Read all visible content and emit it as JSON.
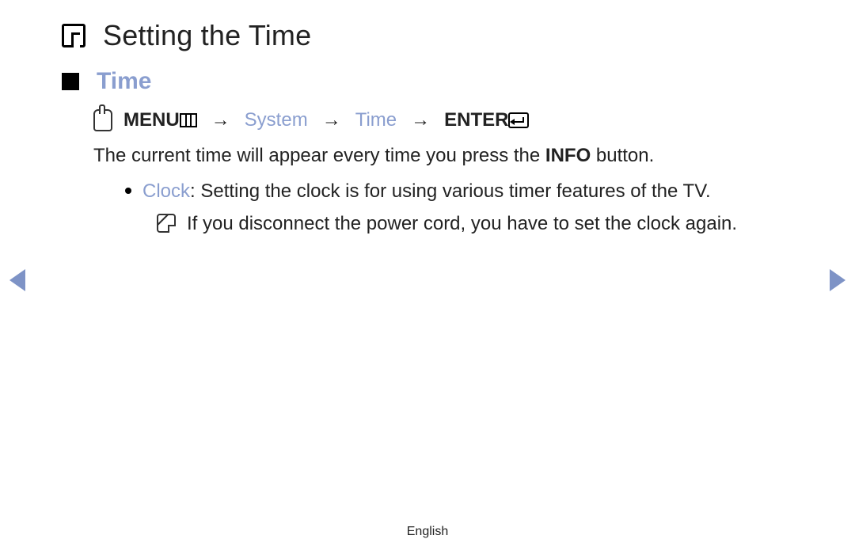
{
  "title": "Setting the Time",
  "section_heading": "Time",
  "breadcrumb": {
    "menu_label": "MENU",
    "arrow": "→",
    "system": "System",
    "time": "Time",
    "enter_label": "ENTER"
  },
  "body": {
    "line1_pre": "The current time will appear every time you press the ",
    "line1_bold": "INFO",
    "line1_post": " button.",
    "bullet_label": "Clock",
    "bullet_text": ": Setting the clock is for using various timer features of the TV.",
    "note_text": "If you disconnect the power cord, you have to set the clock again."
  },
  "footer": "English"
}
